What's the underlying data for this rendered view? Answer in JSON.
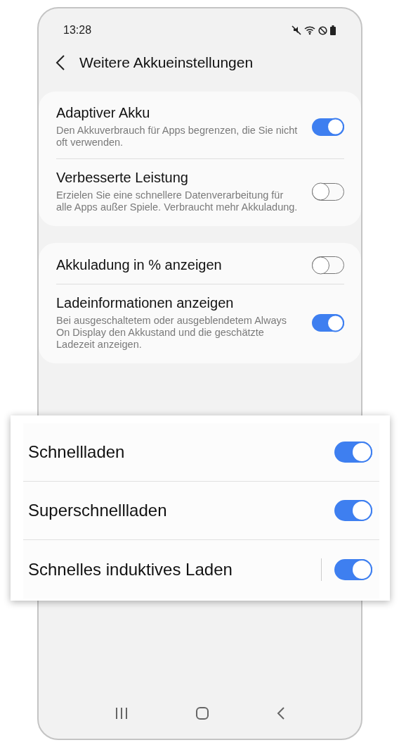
{
  "status_bar": {
    "time": "13:28"
  },
  "header": {
    "title": "Weitere Akkueinstellungen"
  },
  "groups": [
    {
      "items": [
        {
          "title": "Adaptiver Akku",
          "description": "Den Akkuverbrauch für Apps begrenzen, die Sie nicht oft verwenden.",
          "on": true
        },
        {
          "title": "Verbesserte Leistung",
          "description": "Erzielen Sie eine schnellere Datenverarbeitung für alle Apps außer Spiele. Verbraucht mehr Akkuladung.",
          "on": false
        }
      ]
    },
    {
      "items": [
        {
          "title": "Akkuladung in % anzeigen",
          "on": false
        },
        {
          "title": "Ladeinformationen anzeigen",
          "description": "Bei ausgeschaltetem oder ausgeblendetem Always On Display den Akkustand und die geschätzte Ladezeit anzeigen.",
          "on": true
        }
      ]
    }
  ],
  "highlight": {
    "items": [
      {
        "kind": "plain",
        "title": "Schnellladen",
        "on": true
      },
      {
        "kind": "plain",
        "title": "Superschnellladen",
        "on": true
      },
      {
        "kind": "split",
        "title": "Schnelles induktives Laden",
        "on": true
      }
    ]
  }
}
